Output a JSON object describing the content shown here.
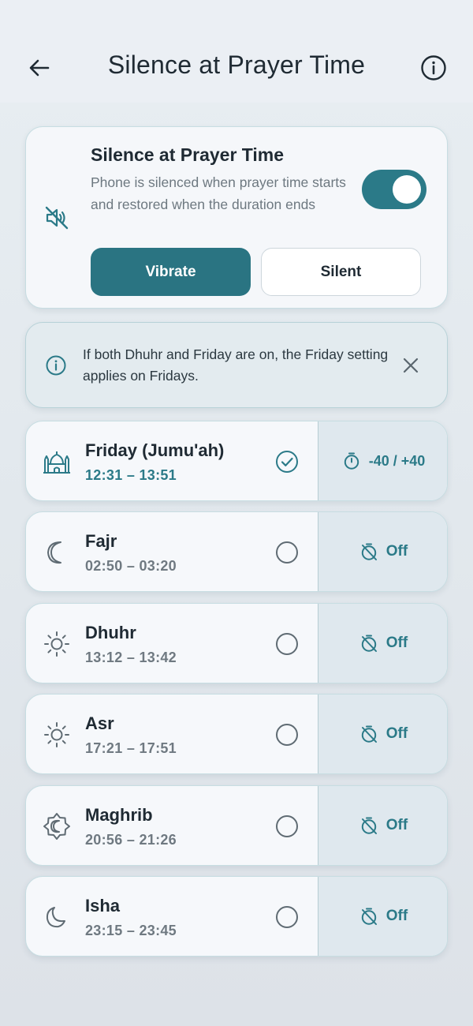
{
  "header": {
    "title": "Silence at Prayer Time",
    "back_icon": "arrow-left-icon",
    "info_icon": "info-circle-icon"
  },
  "main_card": {
    "title": "Silence at Prayer Time",
    "description": "Phone is silenced when prayer time starts and restored when the duration ends",
    "icon": "volume-off-icon",
    "toggle_on": true,
    "modes": [
      {
        "label": "Vibrate",
        "selected": true
      },
      {
        "label": "Silent",
        "selected": false
      }
    ]
  },
  "note": {
    "text": "If both Dhuhr and Friday are on, the Friday setting applies on Fridays.",
    "icon": "info-circle-icon",
    "close_icon": "close-icon"
  },
  "prayers": [
    {
      "name": "Friday (Jumu'ah)",
      "time": "12:31 – 13:51",
      "icon": "mosque-icon",
      "enabled": true,
      "offset": "-40 / +40",
      "offset_icon": "timer-icon"
    },
    {
      "name": "Fajr",
      "time": "02:50 – 03:20",
      "icon": "crescent-moon-icon",
      "enabled": false,
      "offset": "Off",
      "offset_icon": "timer-off-icon"
    },
    {
      "name": "Dhuhr",
      "time": "13:12 – 13:42",
      "icon": "sun-icon",
      "enabled": false,
      "offset": "Off",
      "offset_icon": "timer-off-icon"
    },
    {
      "name": "Asr",
      "time": "17:21 – 17:51",
      "icon": "sun-icon",
      "enabled": false,
      "offset": "Off",
      "offset_icon": "timer-off-icon"
    },
    {
      "name": "Maghrib",
      "time": "20:56 – 21:26",
      "icon": "sunset-moon-icon",
      "enabled": false,
      "offset": "Off",
      "offset_icon": "timer-off-icon"
    },
    {
      "name": "Isha",
      "time": "23:15 – 23:45",
      "icon": "night-moon-icon",
      "enabled": false,
      "offset": "Off",
      "offset_icon": "timer-off-icon"
    }
  ],
  "colors": {
    "accent": "#2b7a88",
    "button": "#2a7482",
    "card_bg": "#f6f8fb",
    "side_bg": "#dfe8ee"
  }
}
